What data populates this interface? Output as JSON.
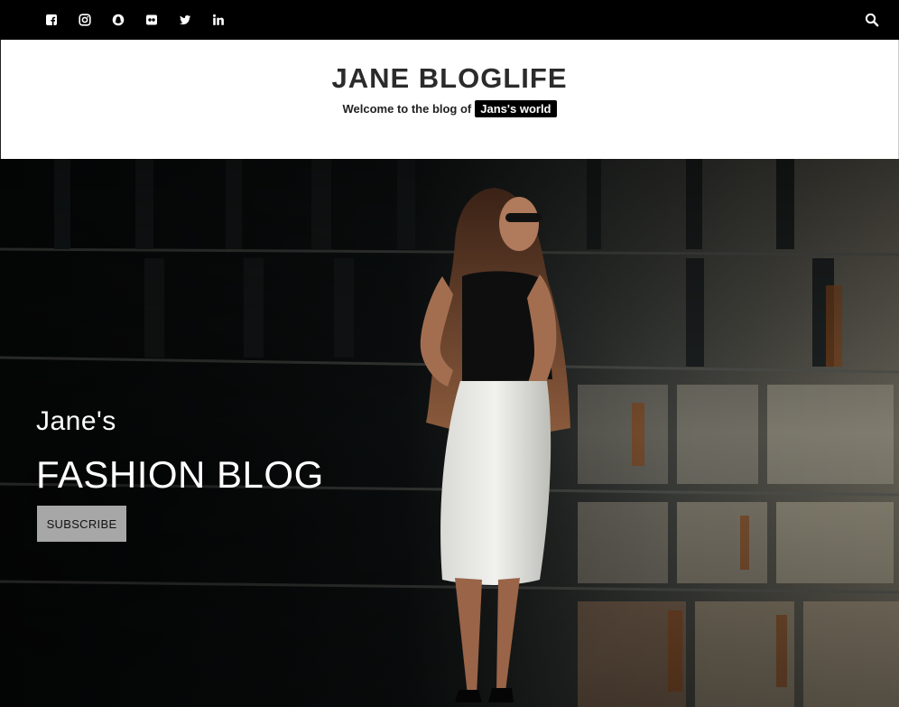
{
  "topbar": {
    "social_icons": [
      "facebook-icon",
      "instagram-icon",
      "snapchat-icon",
      "flickr-icon",
      "twitter-icon",
      "linkedin-icon"
    ],
    "search_icon": "search-icon",
    "background": "#000000"
  },
  "header": {
    "title": "JANE BLOGLIFE",
    "tagline_prefix": "Welcome to the blog of",
    "tagline_highlight": "Jans's world"
  },
  "hero": {
    "pretitle": "Jane's",
    "title": "FASHION BLOG",
    "button_label": "SUBSCRIBE",
    "button_color": "#a7a7a7"
  }
}
